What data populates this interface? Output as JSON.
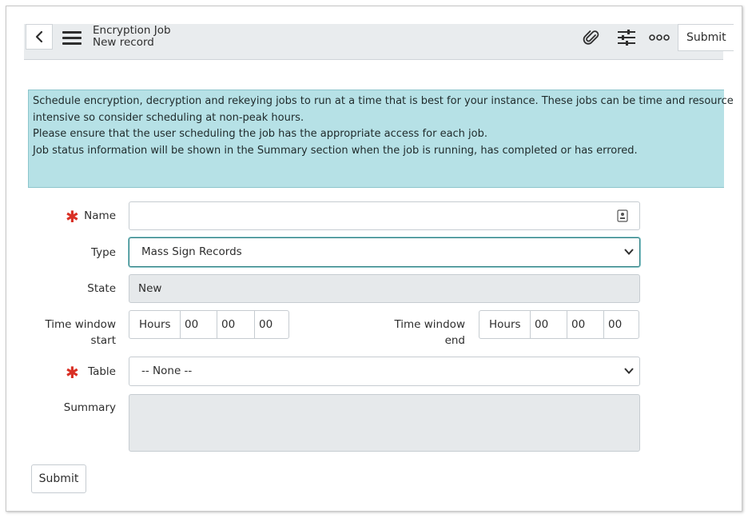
{
  "header": {
    "title": "Encryption Job",
    "subtitle": "New record",
    "submit_label": "Submit"
  },
  "info": {
    "lines": [
      "Schedule encryption, decryption and rekeying jobs to run at a time that is best for your instance. These jobs can be time and resource",
      "intensive so consider scheduling at non-peak hours.",
      "Please ensure that the user scheduling the job has the appropriate access for each job.",
      "Job status information will be shown in the Summary section when the job is running, has completed or has errored."
    ]
  },
  "form": {
    "name": {
      "label": "Name",
      "value": ""
    },
    "type": {
      "label": "Type",
      "value": "Mass Sign Records"
    },
    "state": {
      "label": "State",
      "value": "New"
    },
    "time_window_start": {
      "label_line1": "Time window",
      "label_line2": "start",
      "unit": "Hours",
      "values": [
        "00",
        "00",
        "00"
      ]
    },
    "time_window_end": {
      "label_line1": "Time window",
      "label_line2": "end",
      "unit": "Hours",
      "values": [
        "00",
        "00",
        "00"
      ]
    },
    "table": {
      "label": "Table",
      "value": "-- None --"
    },
    "summary": {
      "label": "Summary",
      "value": ""
    },
    "required_marker": "✱"
  },
  "footer": {
    "submit_label": "Submit"
  },
  "colors": {
    "info_bg": "#b6e1e6",
    "required": "#d93025",
    "focus": "#2e7e82",
    "header_bg": "#e9ecee"
  }
}
